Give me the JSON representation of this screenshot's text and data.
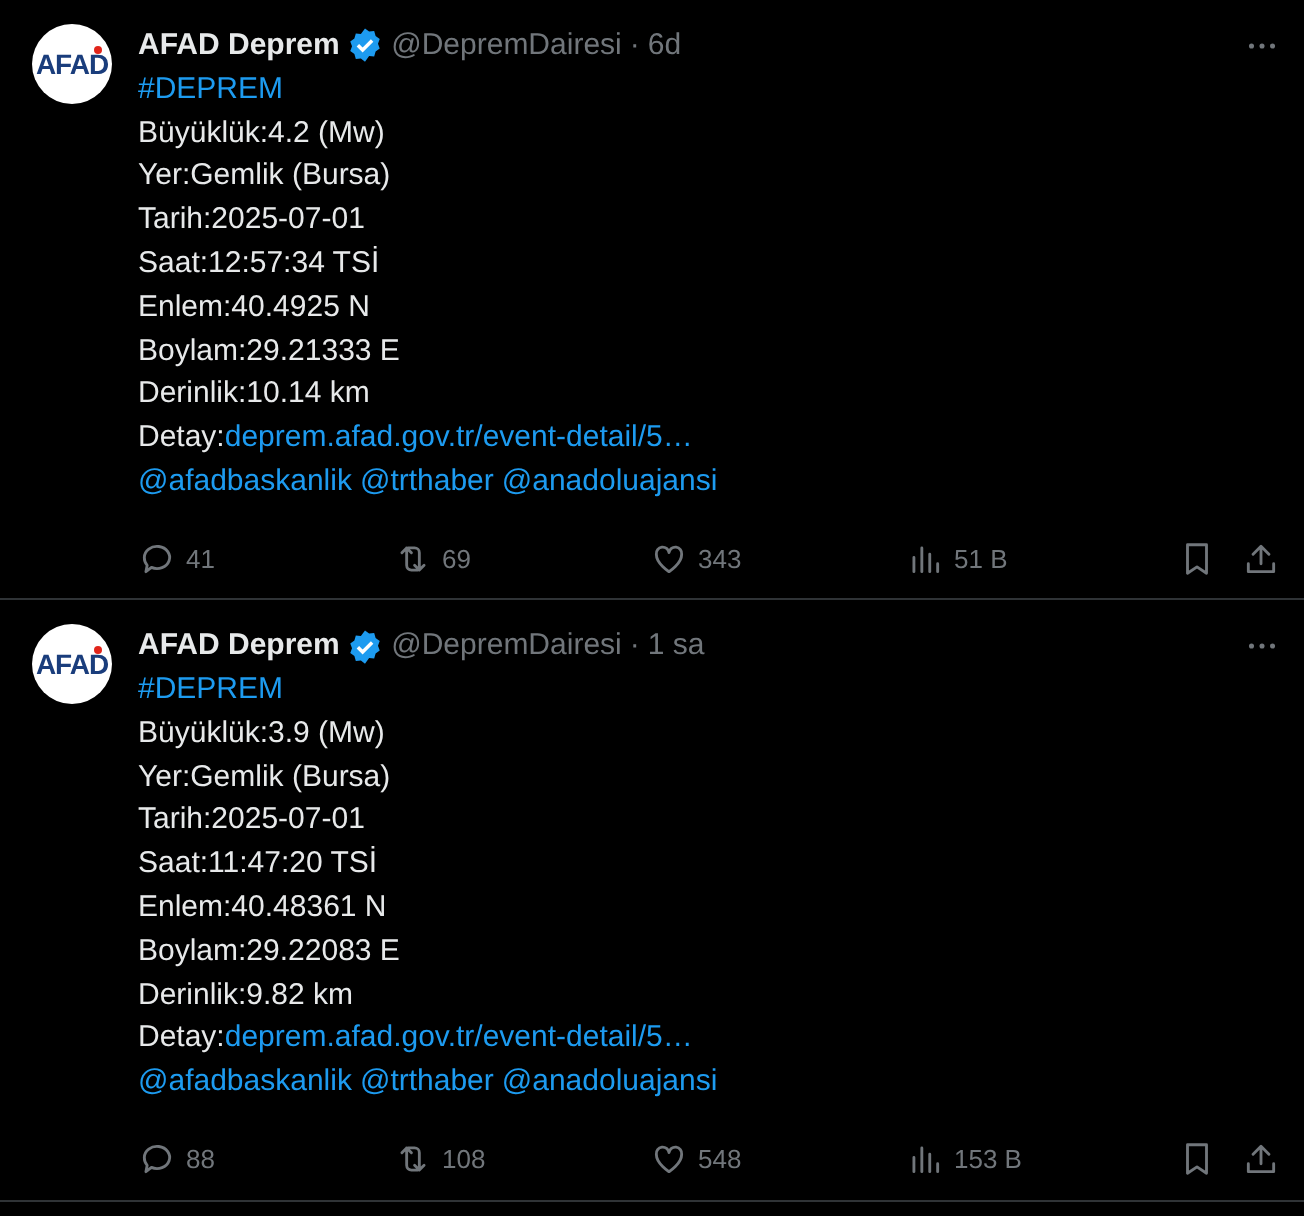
{
  "tweets": [
    {
      "name": "AFAD Deprem",
      "handle": "@DepremDairesi",
      "separator": "·",
      "time": "6d",
      "verified": true,
      "avatar_text": "AFAD",
      "lines": [
        [
          {
            "text": "#DEPREM",
            "link": true
          }
        ],
        [
          {
            "text": "Büyüklük:4.2 (Mw)",
            "link": false
          }
        ],
        [
          {
            "text": "Yer:Gemlik (Bursa)",
            "link": false
          }
        ],
        [
          {
            "text": "Tarih:2025-07-01",
            "link": false
          }
        ],
        [
          {
            "text": "Saat:12:57:34 TSİ",
            "link": false
          }
        ],
        [
          {
            "text": "Enlem:40.4925 N",
            "link": false
          }
        ],
        [
          {
            "text": "Boylam:29.21333 E",
            "link": false
          }
        ],
        [
          {
            "text": "Derinlik:10.14 km",
            "link": false
          }
        ],
        [
          {
            "text": "Detay:",
            "link": false
          },
          {
            "text": "deprem.afad.gov.tr/event-detail/5…",
            "link": true
          }
        ],
        [
          {
            "text": "@afadbaskanlik",
            "link": true
          },
          {
            "text": "@trthaber",
            "link": true
          },
          {
            "text": "@anadoluajansi",
            "link": true
          }
        ]
      ],
      "replies": "41",
      "reposts": "69",
      "likes": "343",
      "views": "51 B"
    },
    {
      "name": "AFAD Deprem",
      "handle": "@DepremDairesi",
      "separator": "·",
      "time": "1 sa",
      "verified": true,
      "avatar_text": "AFAD",
      "lines": [
        [
          {
            "text": "#DEPREM",
            "link": true
          }
        ],
        [
          {
            "text": "Büyüklük:3.9 (Mw)",
            "link": false
          }
        ],
        [
          {
            "text": "Yer:Gemlik (Bursa)",
            "link": false
          }
        ],
        [
          {
            "text": "Tarih:2025-07-01",
            "link": false
          }
        ],
        [
          {
            "text": "Saat:11:47:20 TSİ",
            "link": false
          }
        ],
        [
          {
            "text": "Enlem:40.48361 N",
            "link": false
          }
        ],
        [
          {
            "text": "Boylam:29.22083 E",
            "link": false
          }
        ],
        [
          {
            "text": "Derinlik:9.82 km",
            "link": false
          }
        ],
        [
          {
            "text": "Detay:",
            "link": false
          },
          {
            "text": "deprem.afad.gov.tr/event-detail/5…",
            "link": true
          }
        ],
        [
          {
            "text": "@afadbaskanlik",
            "link": true
          },
          {
            "text": "@trthaber",
            "link": true
          },
          {
            "text": "@anadoluajansi",
            "link": true
          }
        ]
      ],
      "replies": "88",
      "reposts": "108",
      "likes": "548",
      "views": "153 B"
    }
  ]
}
